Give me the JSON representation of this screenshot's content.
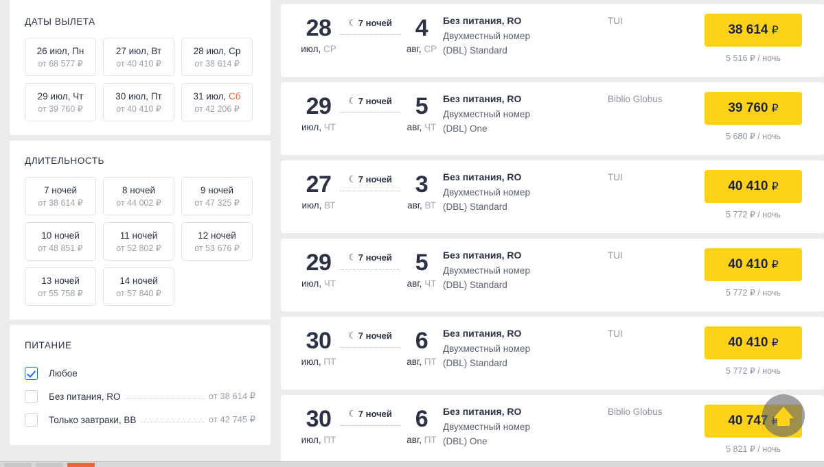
{
  "sidebar": {
    "departure_dates": {
      "title": "ДАТЫ ВЫЛЕТА",
      "options": [
        {
          "date": "26 июл, ",
          "dow": "Пн",
          "weekend": false,
          "price": "от 68 577 ₽"
        },
        {
          "date": "27 июл, ",
          "dow": "Вт",
          "weekend": false,
          "price": "от 40 410 ₽"
        },
        {
          "date": "28 июл, ",
          "dow": "Ср",
          "weekend": false,
          "price": "от 38 614 ₽"
        },
        {
          "date": "29 июл, ",
          "dow": "Чт",
          "weekend": false,
          "price": "от 39 760 ₽"
        },
        {
          "date": "30 июл, ",
          "dow": "Пт",
          "weekend": false,
          "price": "от 40 410 ₽"
        },
        {
          "date": "31 июл, ",
          "dow": "Сб",
          "weekend": true,
          "price": "от 42 206 ₽"
        }
      ]
    },
    "duration": {
      "title": "ДЛИТЕЛЬНОСТЬ",
      "options": [
        {
          "label": "7 ночей",
          "price": "от 38 614 ₽"
        },
        {
          "label": "8 ночей",
          "price": "от 44 002 ₽"
        },
        {
          "label": "9 ночей",
          "price": "от 47 325 ₽"
        },
        {
          "label": "10 ночей",
          "price": "от 48 851 ₽"
        },
        {
          "label": "11 ночей",
          "price": "от 52 802 ₽"
        },
        {
          "label": "12 ночей",
          "price": "от 53 676 ₽"
        },
        {
          "label": "13 ночей",
          "price": "от 55 758 ₽"
        },
        {
          "label": "14 ночей",
          "price": "от 57 840 ₽"
        }
      ]
    },
    "meals": {
      "title": "ПИТАНИЕ",
      "options": [
        {
          "label": "Любое",
          "checked": true,
          "price": ""
        },
        {
          "label": "Без питания, RO",
          "checked": false,
          "price": "от 38 614 ₽"
        },
        {
          "label": "Только завтраки, BB",
          "checked": false,
          "price": "от 42 745 ₽"
        }
      ]
    }
  },
  "results": {
    "nights_icon": "moon-icon",
    "currency": "₽",
    "per_night_suffix": "₽ / ночь",
    "cards": [
      {
        "start_day": "28",
        "start_month": "июл, ",
        "start_dow": "СР",
        "nights": "7 ночей",
        "end_day": "4",
        "end_month": "авг, ",
        "end_dow": "СР",
        "meal": "Без питания, RO",
        "room_line1": "Двухместный номер",
        "room_line2": "(DBL) Standard",
        "operator": "TUI",
        "price": "38 614",
        "per_night": "5 516 ₽ / ночь"
      },
      {
        "start_day": "29",
        "start_month": "июл, ",
        "start_dow": "ЧТ",
        "nights": "7 ночей",
        "end_day": "5",
        "end_month": "авг, ",
        "end_dow": "ЧТ",
        "meal": "Без питания, RO",
        "room_line1": "Двухместный номер",
        "room_line2": "(DBL) One",
        "operator": "Biblio Globus",
        "price": "39 760",
        "per_night": "5 680 ₽ / ночь"
      },
      {
        "start_day": "27",
        "start_month": "июл, ",
        "start_dow": "ВТ",
        "nights": "7 ночей",
        "end_day": "3",
        "end_month": "авг, ",
        "end_dow": "ВТ",
        "meal": "Без питания, RO",
        "room_line1": "Двухместный номер",
        "room_line2": "(DBL) Standard",
        "operator": "TUI",
        "price": "40 410",
        "per_night": "5 772 ₽ / ночь"
      },
      {
        "start_day": "29",
        "start_month": "июл, ",
        "start_dow": "ЧТ",
        "nights": "7 ночей",
        "end_day": "5",
        "end_month": "авг, ",
        "end_dow": "ЧТ",
        "meal": "Без питания, RO",
        "room_line1": "Двухместный номер",
        "room_line2": "(DBL) Standard",
        "operator": "TUI",
        "price": "40 410",
        "per_night": "5 772 ₽ / ночь"
      },
      {
        "start_day": "30",
        "start_month": "июл, ",
        "start_dow": "ПТ",
        "nights": "7 ночей",
        "end_day": "6",
        "end_month": "авг, ",
        "end_dow": "ПТ",
        "meal": "Без питания, RO",
        "room_line1": "Двухместный номер",
        "room_line2": "(DBL) Standard",
        "operator": "TUI",
        "price": "40 410",
        "per_night": "5 772 ₽ / ночь"
      },
      {
        "start_day": "30",
        "start_month": "июл, ",
        "start_dow": "ПТ",
        "nights": "7 ночей",
        "end_day": "6",
        "end_month": "авг, ",
        "end_dow": "ПТ",
        "meal": "Без питания, RO",
        "room_line1": "Двухместный номер",
        "room_line2": "(DBL) One",
        "operator": "Biblio Globus",
        "price": "40 747",
        "per_night": "5 821 ₽ / ночь"
      }
    ]
  },
  "scroll_top": {
    "icon": "arrow-up-icon"
  },
  "colors": {
    "accent_yellow": "#FFD21A",
    "checkbox_blue": "#1A6EF5",
    "weekend_red": "#E8603C",
    "text_dark": "#2B3245",
    "text_muted": "#9AA0AC",
    "page_bg": "#ECECEC"
  }
}
